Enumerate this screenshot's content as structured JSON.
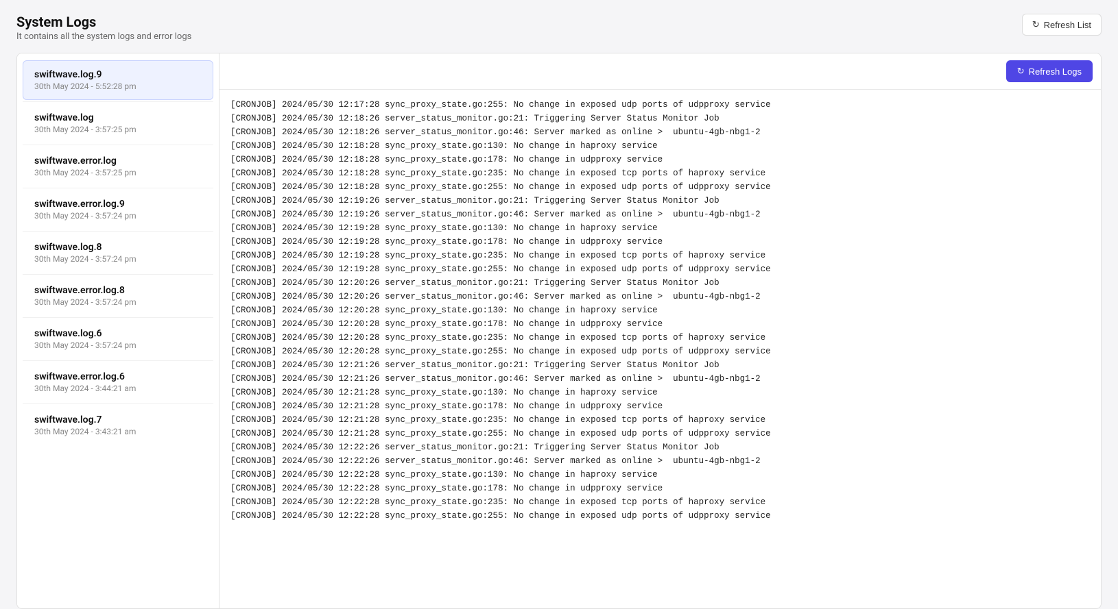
{
  "header": {
    "title": "System Logs",
    "subtitle": "It contains all the system logs and error logs",
    "refresh_list_label": "Refresh List"
  },
  "refresh_logs_label": "Refresh Logs",
  "sidebar": {
    "items": [
      {
        "name": "swiftwave.log.9",
        "date": "30th May 2024 - 5:52:28 pm",
        "active": true
      },
      {
        "name": "swiftwave.log",
        "date": "30th May 2024 - 3:57:25 pm",
        "active": false
      },
      {
        "name": "swiftwave.error.log",
        "date": "30th May 2024 - 3:57:25 pm",
        "active": false
      },
      {
        "name": "swiftwave.error.log.9",
        "date": "30th May 2024 - 3:57:24 pm",
        "active": false
      },
      {
        "name": "swiftwave.log.8",
        "date": "30th May 2024 - 3:57:24 pm",
        "active": false
      },
      {
        "name": "swiftwave.error.log.8",
        "date": "30th May 2024 - 3:57:24 pm",
        "active": false
      },
      {
        "name": "swiftwave.log.6",
        "date": "30th May 2024 - 3:57:24 pm",
        "active": false
      },
      {
        "name": "swiftwave.error.log.6",
        "date": "30th May 2024 - 3:44:21 am",
        "active": false
      },
      {
        "name": "swiftwave.log.7",
        "date": "30th May 2024 - 3:43:21 am",
        "active": false
      }
    ]
  },
  "log_lines": [
    "[CRONJOB] 2024/05/30 12:17:28 sync_proxy_state.go:255: No change in exposed udp ports of udpproxy service",
    "[CRONJOB] 2024/05/30 12:18:26 server_status_monitor.go:21: Triggering Server Status Monitor Job",
    "[CRONJOB] 2024/05/30 12:18:26 server_status_monitor.go:46: Server marked as online >  ubuntu-4gb-nbg1-2",
    "[CRONJOB] 2024/05/30 12:18:28 sync_proxy_state.go:130: No change in haproxy service",
    "[CRONJOB] 2024/05/30 12:18:28 sync_proxy_state.go:178: No change in udpproxy service",
    "[CRONJOB] 2024/05/30 12:18:28 sync_proxy_state.go:235: No change in exposed tcp ports of haproxy service",
    "[CRONJOB] 2024/05/30 12:18:28 sync_proxy_state.go:255: No change in exposed udp ports of udpproxy service",
    "[CRONJOB] 2024/05/30 12:19:26 server_status_monitor.go:21: Triggering Server Status Monitor Job",
    "[CRONJOB] 2024/05/30 12:19:26 server_status_monitor.go:46: Server marked as online >  ubuntu-4gb-nbg1-2",
    "[CRONJOB] 2024/05/30 12:19:28 sync_proxy_state.go:130: No change in haproxy service",
    "[CRONJOB] 2024/05/30 12:19:28 sync_proxy_state.go:178: No change in udpproxy service",
    "[CRONJOB] 2024/05/30 12:19:28 sync_proxy_state.go:235: No change in exposed tcp ports of haproxy service",
    "[CRONJOB] 2024/05/30 12:19:28 sync_proxy_state.go:255: No change in exposed udp ports of udpproxy service",
    "[CRONJOB] 2024/05/30 12:20:26 server_status_monitor.go:21: Triggering Server Status Monitor Job",
    "[CRONJOB] 2024/05/30 12:20:26 server_status_monitor.go:46: Server marked as online >  ubuntu-4gb-nbg1-2",
    "[CRONJOB] 2024/05/30 12:20:28 sync_proxy_state.go:130: No change in haproxy service",
    "[CRONJOB] 2024/05/30 12:20:28 sync_proxy_state.go:178: No change in udpproxy service",
    "[CRONJOB] 2024/05/30 12:20:28 sync_proxy_state.go:235: No change in exposed tcp ports of haproxy service",
    "[CRONJOB] 2024/05/30 12:20:28 sync_proxy_state.go:255: No change in exposed udp ports of udpproxy service",
    "[CRONJOB] 2024/05/30 12:21:26 server_status_monitor.go:21: Triggering Server Status Monitor Job",
    "[CRONJOB] 2024/05/30 12:21:26 server_status_monitor.go:46: Server marked as online >  ubuntu-4gb-nbg1-2",
    "[CRONJOB] 2024/05/30 12:21:28 sync_proxy_state.go:130: No change in haproxy service",
    "[CRONJOB] 2024/05/30 12:21:28 sync_proxy_state.go:178: No change in udpproxy service",
    "[CRONJOB] 2024/05/30 12:21:28 sync_proxy_state.go:235: No change in exposed tcp ports of haproxy service",
    "[CRONJOB] 2024/05/30 12:21:28 sync_proxy_state.go:255: No change in exposed udp ports of udpproxy service",
    "[CRONJOB] 2024/05/30 12:22:26 server_status_monitor.go:21: Triggering Server Status Monitor Job",
    "[CRONJOB] 2024/05/30 12:22:26 server_status_monitor.go:46: Server marked as online >  ubuntu-4gb-nbg1-2",
    "[CRONJOB] 2024/05/30 12:22:28 sync_proxy_state.go:130: No change in haproxy service",
    "[CRONJOB] 2024/05/30 12:22:28 sync_proxy_state.go:178: No change in udpproxy service",
    "[CRONJOB] 2024/05/30 12:22:28 sync_proxy_state.go:235: No change in exposed tcp ports of haproxy service",
    "[CRONJOB] 2024/05/30 12:22:28 sync_proxy_state.go:255: No change in exposed udp ports of udpproxy service"
  ]
}
